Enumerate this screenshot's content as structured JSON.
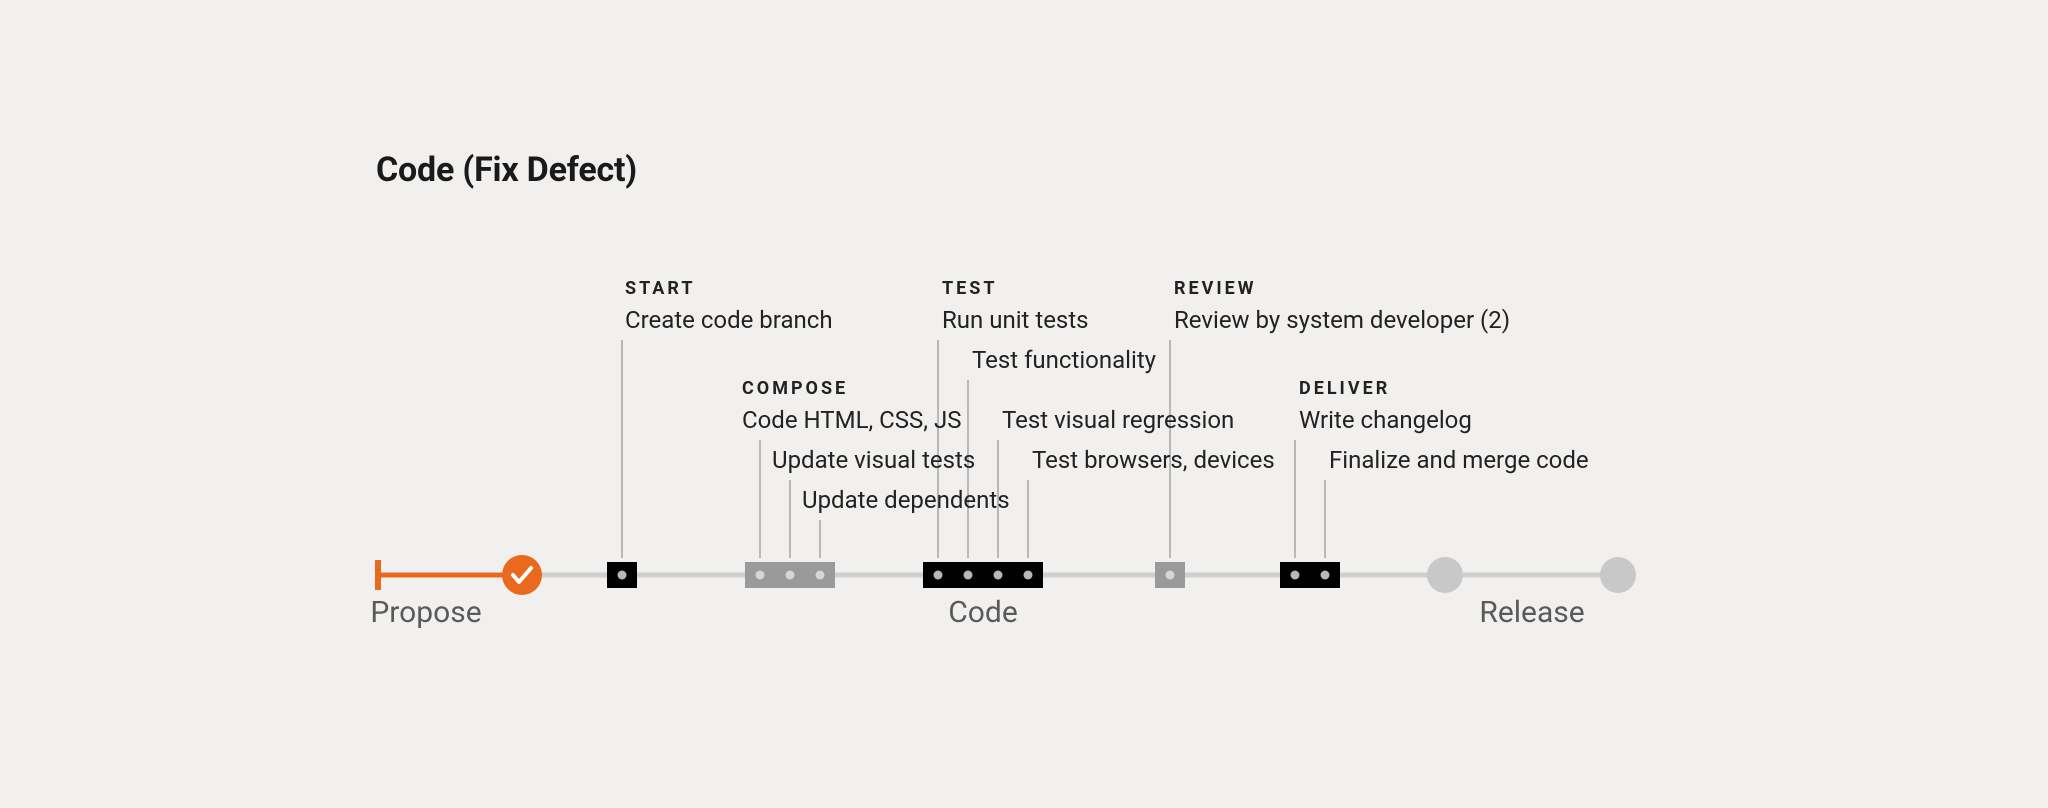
{
  "title": "Code (Fix Defect)",
  "phases": {
    "propose": "Propose",
    "code": "Code",
    "release": "Release"
  },
  "categories": {
    "start": "Start",
    "compose": "Compose",
    "test": "Test",
    "review": "Review",
    "deliver": "Deliver"
  },
  "tasks": {
    "create_branch": "Create code branch",
    "code_html_css_js": "Code HTML, CSS, JS",
    "update_visual_tests": "Update visual tests",
    "update_dependents": "Update dependents",
    "run_unit_tests": "Run unit tests",
    "test_functionality": "Test functionality",
    "test_visual_regression": "Test visual regression",
    "test_browsers_devices": "Test browsers, devices",
    "review_by_system_developer": "Review by system developer (2)",
    "write_changelog": "Write changelog",
    "finalize_merge": "Finalize and merge code"
  }
}
